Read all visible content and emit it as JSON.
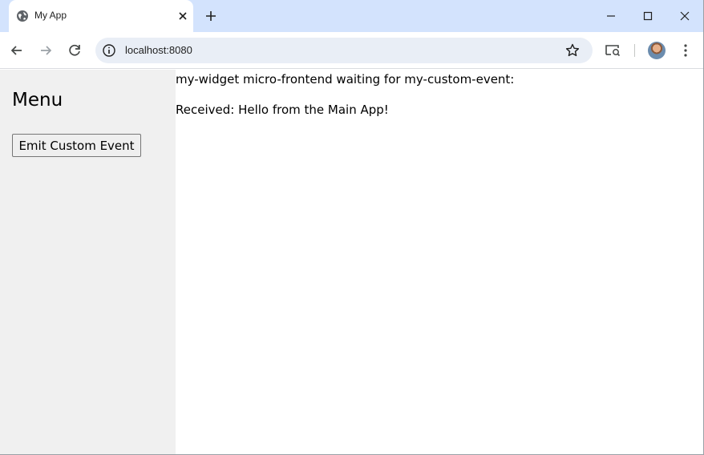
{
  "browser": {
    "tab": {
      "title": "My App",
      "favicon": "globe-icon",
      "close_icon": "close-icon"
    },
    "new_tab_icon": "plus-icon",
    "window_controls": [
      "minimize-icon",
      "maximize-icon",
      "close-icon"
    ],
    "nav_icons": [
      "back-arrow-icon",
      "forward-arrow-icon",
      "reload-icon"
    ],
    "address": {
      "url": "localhost:8080",
      "info_icon": "info-icon",
      "bookmark_icon": "star-icon"
    },
    "toolbar_icons": [
      "cast-icon",
      "avatar",
      "more-vert-icon"
    ],
    "colors": {
      "tabbar_bg": "#d3e3fd",
      "omnibox_bg": "#e9eef6"
    }
  },
  "sidebar": {
    "title": "Menu",
    "button_label": "Emit Custom Event",
    "bg_color": "#f0f0f0"
  },
  "main": {
    "widget_heading": "my-widget micro-frontend waiting for my-custom-event:",
    "received_text": "Received: Hello from the Main App!"
  }
}
